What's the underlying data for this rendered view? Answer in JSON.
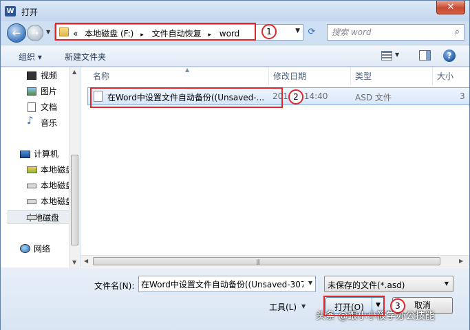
{
  "window": {
    "title": "打开",
    "app_icon": "W"
  },
  "address": {
    "breadcrumb_prefix": "«",
    "crumbs": [
      "本地磁盘 (F:)",
      "文件自动恢复",
      "word"
    ],
    "separator": "▸"
  },
  "search": {
    "placeholder": "搜索 word"
  },
  "toolbar": {
    "organize": "组织 ▾",
    "new_folder": "新建文件夹"
  },
  "nav": {
    "items": [
      {
        "label": "视频",
        "icon": "video-library-icon"
      },
      {
        "label": "图片",
        "icon": "picture-library-icon"
      },
      {
        "label": "文档",
        "icon": "document-library-icon"
      },
      {
        "label": "音乐",
        "icon": "music-library-icon"
      },
      {
        "label": "计算机",
        "icon": "computer-icon"
      },
      {
        "label": "本地磁盘",
        "icon": "system-drive-icon"
      },
      {
        "label": "本地磁盘",
        "icon": "drive-icon"
      },
      {
        "label": "本地磁盘",
        "icon": "drive-icon"
      },
      {
        "label": "本地磁盘",
        "icon": "drive-icon"
      },
      {
        "label": "网络",
        "icon": "network-icon"
      }
    ]
  },
  "columns": {
    "name": "名称",
    "modified": "修改日期",
    "type": "类型",
    "size": "大小"
  },
  "files": [
    {
      "name": "在Word中设置文件自动备份((Unsaved-...",
      "modified": "201 29 14:40",
      "type": "ASD 文件",
      "size": "3"
    }
  ],
  "bottom": {
    "filename_label": "文件名(N):",
    "filename_value": "在Word中设置文件自动备份((Unsaved-307",
    "filetype": "未保存的文件(*.asd)",
    "tools": "工具(L)",
    "open": "打开(O)",
    "cancel": "取消"
  },
  "annotations": [
    "1",
    "2",
    "3"
  ],
  "watermark": "头条 @跟小小筱学办公技能",
  "colors": {
    "annotation": "#e0262b",
    "selection": "#d7e7fa",
    "accent": "#3c7fb1"
  }
}
